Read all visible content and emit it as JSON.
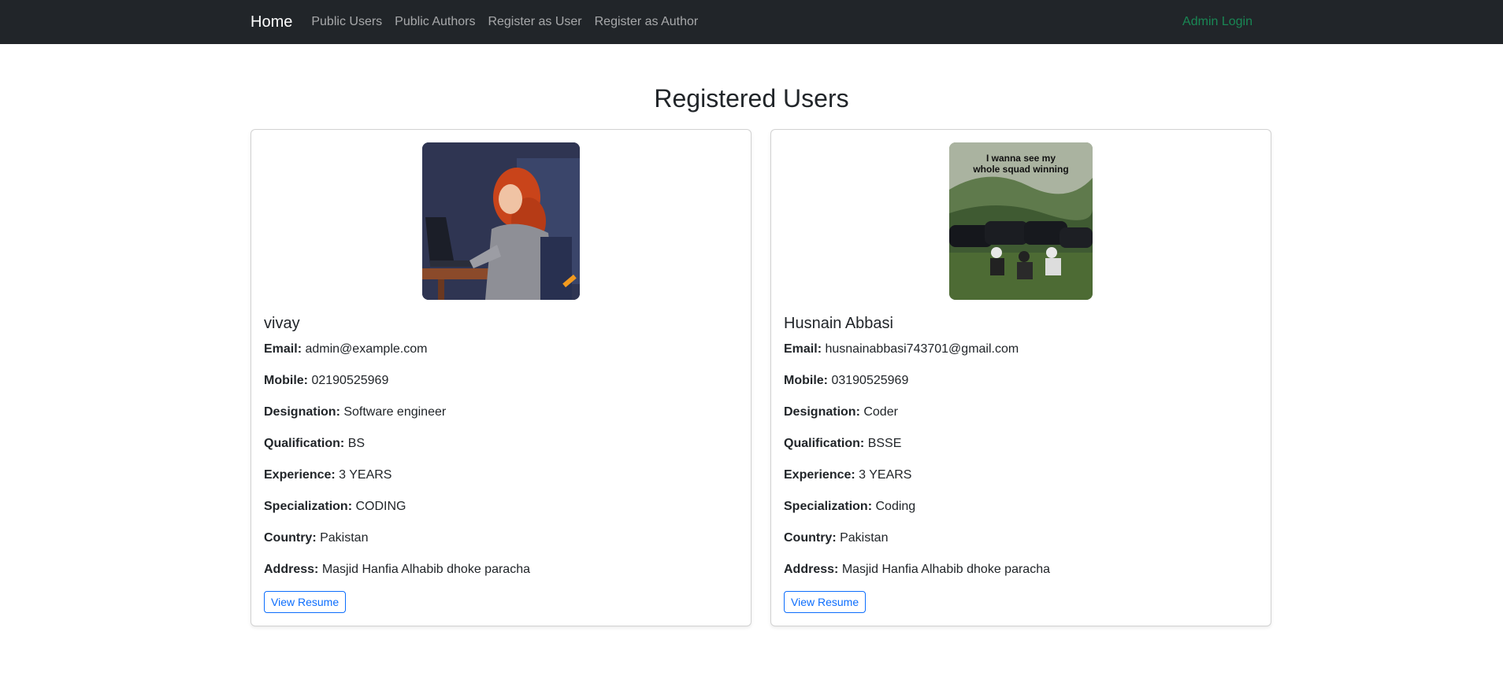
{
  "navbar": {
    "brand": "Home",
    "links": [
      "Public Users",
      "Public Authors",
      "Register as User",
      "Register as Author"
    ],
    "admin": "Admin Login"
  },
  "page": {
    "title": "Registered Users"
  },
  "labels": {
    "email": "Email:",
    "mobile": "Mobile:",
    "designation": "Designation:",
    "qualification": "Qualification:",
    "experience": "Experience:",
    "specialization": "Specialization:",
    "country": "Country:",
    "address": "Address:",
    "resume_button": "View Resume"
  },
  "users": [
    {
      "name": "vivay",
      "email": "admin@example.com",
      "mobile": "02190525969",
      "designation": "Software engineer",
      "qualification": "BS",
      "experience": "3 YEARS",
      "specialization": "CODING",
      "country": "Pakistan",
      "address": "Masjid Hanfia Alhabib dhoke paracha"
    },
    {
      "name": "Husnain Abbasi",
      "email": "husnainabbasi743701@gmail.com",
      "mobile": "03190525969",
      "designation": "Coder",
      "qualification": "BSSE",
      "experience": "3 YEARS",
      "specialization": "Coding",
      "country": "Pakistan",
      "address": "Masjid Hanfia Alhabib dhoke paracha",
      "photo_caption": "I wanna see my whole squad winning"
    }
  ]
}
